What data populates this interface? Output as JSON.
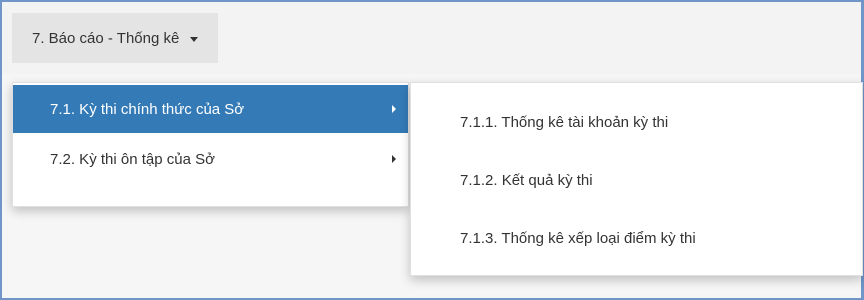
{
  "navbar": {
    "menu_label": "7. Báo cáo - Thống kê"
  },
  "menu": {
    "items": [
      {
        "label": "7.1. Kỳ thi chính thức của Sở",
        "active": true
      },
      {
        "label": "7.2. Kỳ thi ôn tập của Sở",
        "active": false
      }
    ]
  },
  "submenu": {
    "items": [
      {
        "label": "7.1.1. Thống kê tài khoản kỳ thi"
      },
      {
        "label": "7.1.2. Kết quả kỳ thi"
      },
      {
        "label": "7.1.3. Thống kê xếp loại điểm kỳ thi"
      }
    ]
  },
  "colors": {
    "active_bg": "#337ab7",
    "frame_border": "#6f95c9",
    "nav_item_bg": "#e4e4e4"
  },
  "icons": {
    "nav_caret": "caret-down-icon",
    "submenu_arrow": "caret-right-icon"
  }
}
